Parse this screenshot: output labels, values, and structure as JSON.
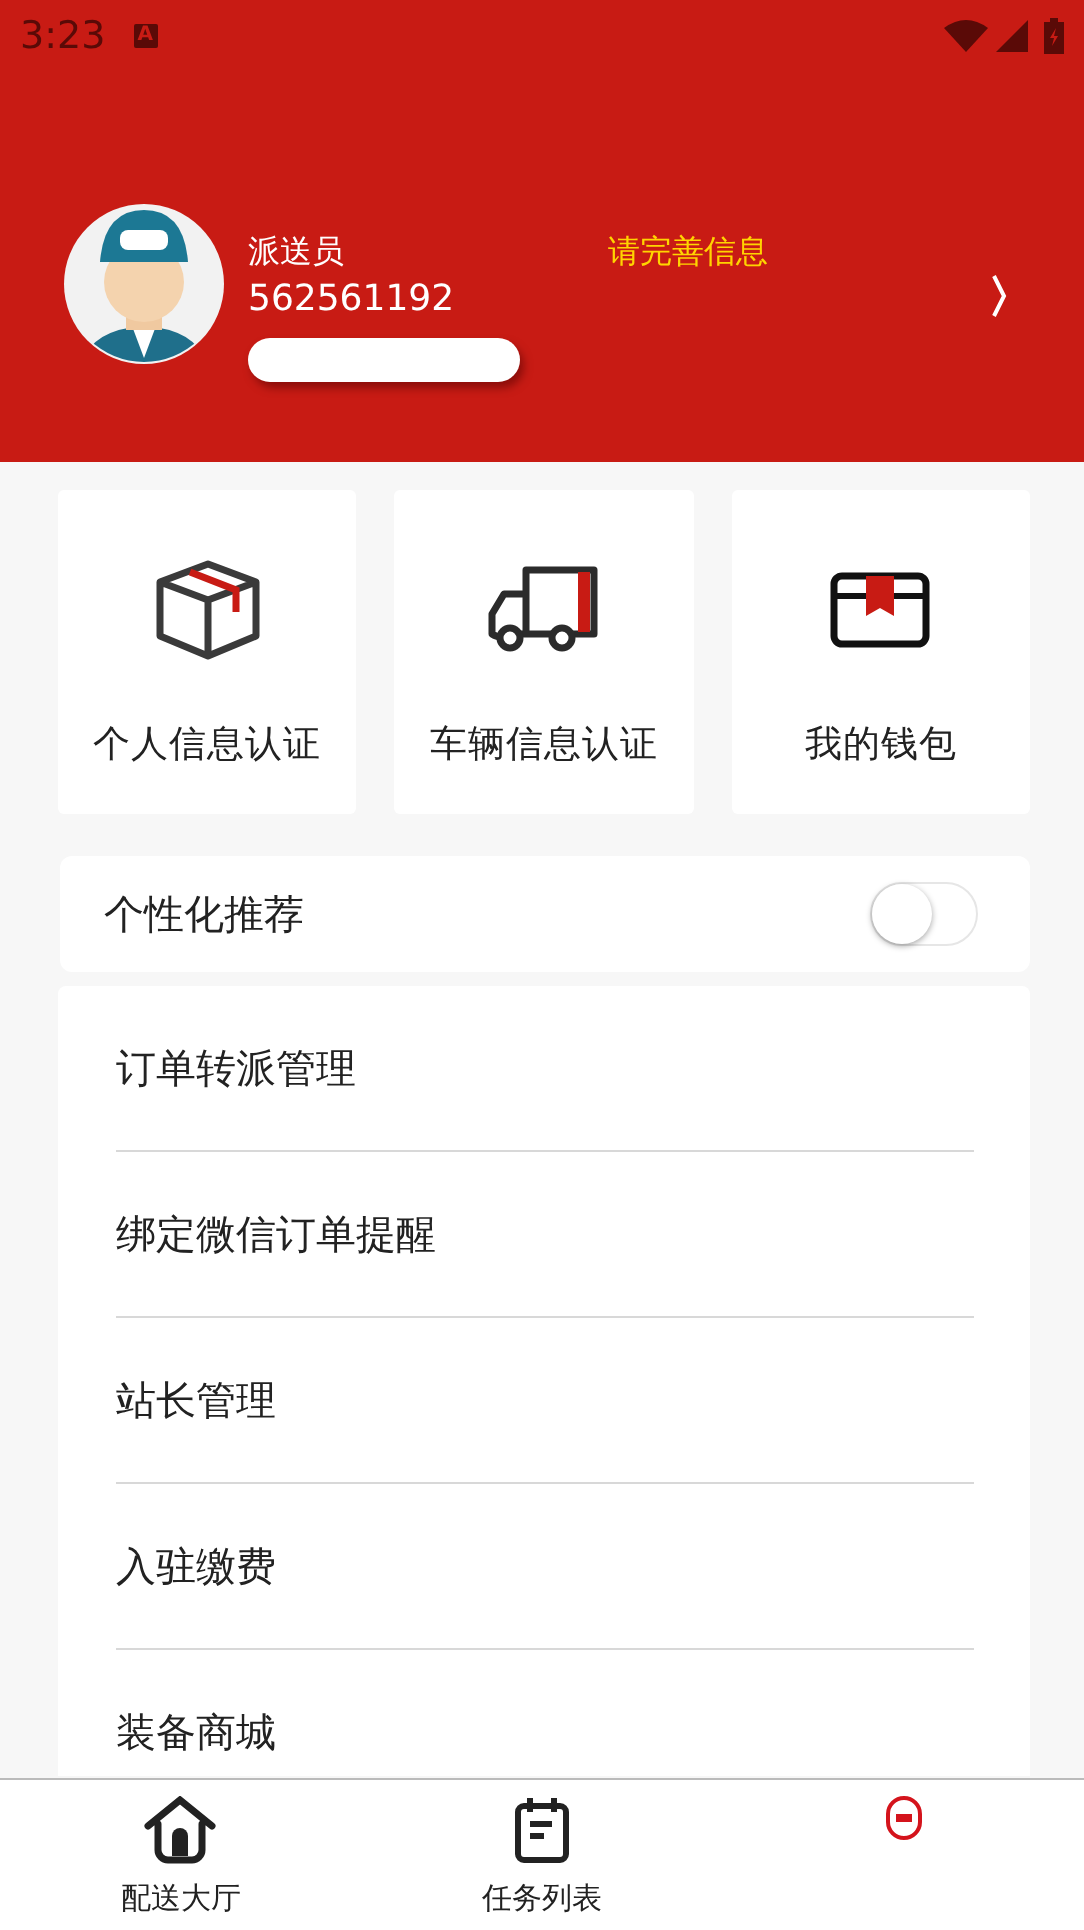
{
  "status_bar": {
    "time": "3:23",
    "notification": "A"
  },
  "profile": {
    "role": "派送员",
    "id": "562561192",
    "prompt": "请完善信息"
  },
  "cards": [
    {
      "kind": "box",
      "label": "个人信息认证"
    },
    {
      "kind": "truck",
      "label": "车辆信息认证"
    },
    {
      "kind": "wallet",
      "label": "我的钱包"
    }
  ],
  "recommend": {
    "label": "个性化推荐",
    "on": false
  },
  "menu": [
    {
      "label": "订单转派管理"
    },
    {
      "label": "绑定微信订单提醒"
    },
    {
      "label": "站长管理"
    },
    {
      "label": "入驻缴费"
    },
    {
      "label": "装备商城"
    }
  ],
  "tabs": [
    {
      "kind": "home",
      "label": "配送大厅",
      "selected": false
    },
    {
      "kind": "tasks",
      "label": "任务列表",
      "selected": false
    },
    {
      "kind": "mine",
      "selected": true
    }
  ]
}
